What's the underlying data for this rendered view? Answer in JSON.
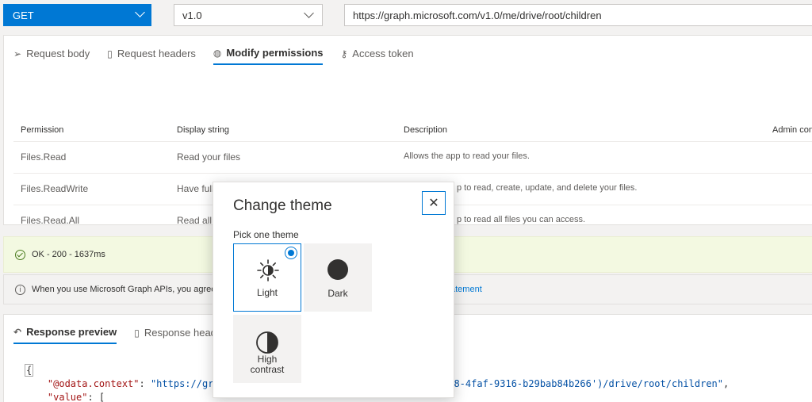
{
  "topbar": {
    "method": "GET",
    "version": "v1.0",
    "url": "https://graph.microsoft.com/v1.0/me/drive/root/children"
  },
  "request_tabs": [
    {
      "label": "Request body",
      "icon": "send-icon"
    },
    {
      "label": "Request headers",
      "icon": "document-icon"
    },
    {
      "label": "Modify permissions",
      "icon": "lock-icon"
    },
    {
      "label": "Access token",
      "icon": "key-icon"
    }
  ],
  "permissions": {
    "headers": [
      "Permission",
      "Display string",
      "Description",
      "Admin con"
    ],
    "rows": [
      {
        "permission": "Files.Read",
        "display": "Read your files",
        "description": "Allows the app to read your files."
      },
      {
        "permission": "Files.ReadWrite",
        "display": "Have full",
        "description": "p to read, create, update, and delete your files."
      },
      {
        "permission": "Files.Read.All",
        "display": "Read all",
        "description": "p to read all files you can access."
      }
    ]
  },
  "status": {
    "ok_text": "OK - 200 - 1637ms",
    "info_text": "When you use Microsoft Graph APIs, you agree t",
    "info_link": "atement"
  },
  "response_tabs": [
    {
      "label": "Response preview",
      "icon": "arrow-back-icon"
    },
    {
      "label": "Response header",
      "icon": "document-icon"
    }
  ],
  "response_code": {
    "brace": "{",
    "line1_key": "\"@odata.context\"",
    "line1_sep": ": ",
    "line1_val_a": "\"https://grap",
    "line1_val_b": "183-b208-4faf-9316-b29bab84b266')/drive/root/children\"",
    "line1_end": ",",
    "line2_key": "\"value\"",
    "line2_rest": ": ["
  },
  "modal": {
    "title": "Change theme",
    "close_glyph": "✕",
    "pick_label": "Pick one theme",
    "themes": [
      {
        "label": "Light",
        "selected": true
      },
      {
        "label": "Dark",
        "selected": false
      },
      {
        "label": "High contrast",
        "selected": false
      }
    ]
  },
  "colors": {
    "accent": "#0078d4",
    "ok_bg": "#f3f9e1"
  }
}
